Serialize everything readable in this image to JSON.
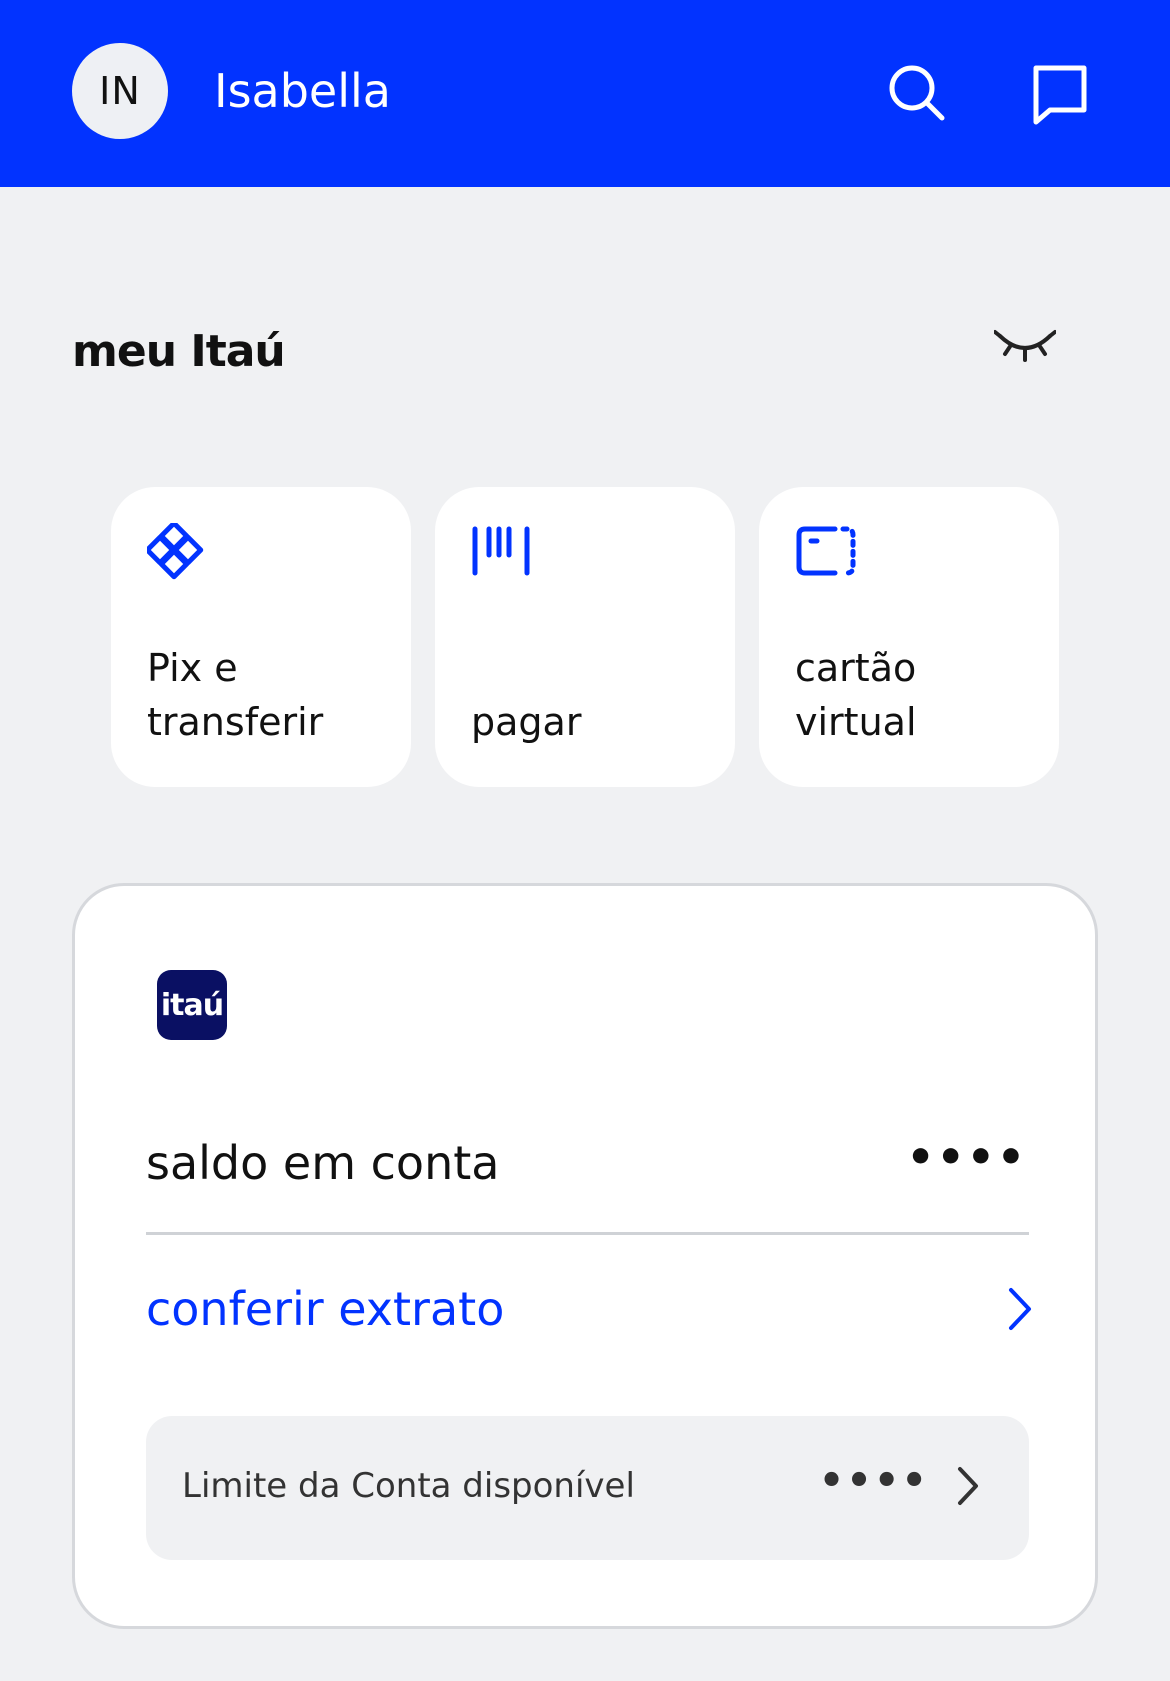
{
  "header": {
    "avatar_initials": "IN",
    "user_name": "Isabella",
    "bg_color": "#0233ff"
  },
  "section": {
    "title": "meu Itaú"
  },
  "quick_actions": [
    {
      "line1": "Pix e",
      "line2": "transferir",
      "icon": "pix-icon"
    },
    {
      "line1": "",
      "line2": "pagar",
      "icon": "barcode-icon"
    },
    {
      "line1": "cartão",
      "line2": "virtual",
      "icon": "virtual-card-icon"
    }
  ],
  "account_card": {
    "logo_text": "itaú",
    "balance_label": "saldo em conta",
    "balance_value": "••••",
    "statement_link": "conferir extrato",
    "limit_label": "Limite da Conta disponível",
    "limit_value": "••••"
  },
  "colors": {
    "accent": "#0233ff",
    "logo_bg": "#0a1063",
    "page_bg": "#f0f1f3"
  }
}
